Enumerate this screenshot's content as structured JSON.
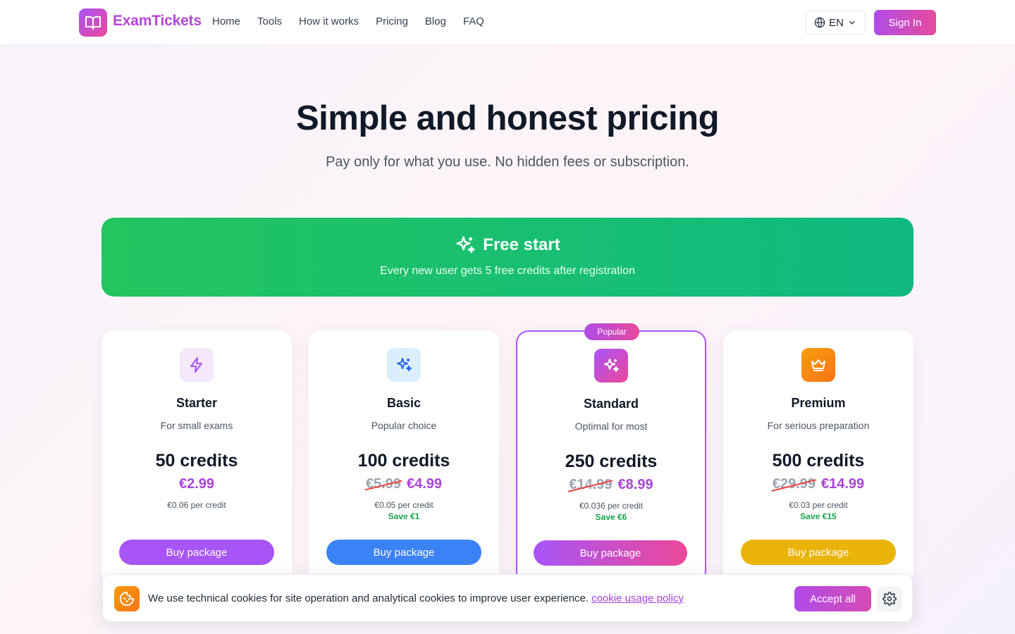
{
  "header": {
    "brand": "ExamTickets",
    "nav": [
      "Home",
      "Tools",
      "How it works",
      "Pricing",
      "Blog",
      "FAQ"
    ],
    "language": "EN",
    "sign_in": "Sign In"
  },
  "hero": {
    "title": "Simple and honest pricing",
    "subtitle": "Pay only for what you use. No hidden fees or subscription."
  },
  "free_banner": {
    "title": "Free start",
    "subtitle": "Every new user gets 5 free credits after registration"
  },
  "plans": [
    {
      "name": "Starter",
      "description": "For small exams",
      "credits": "50 credits",
      "old_price": "",
      "price": "€2.99",
      "per_credit": "€0.06 per credit",
      "save": "",
      "button": "Buy package",
      "icon": "lightning-icon",
      "accent": "#a855f7"
    },
    {
      "name": "Basic",
      "description": "Popular choice",
      "credits": "100 credits",
      "old_price": "€5.99",
      "price": "€4.99",
      "per_credit": "€0.05 per credit",
      "save": "Save €1",
      "button": "Buy package",
      "icon": "sparkles-icon",
      "accent": "#3b82f6"
    },
    {
      "name": "Standard",
      "description": "Optimal for most",
      "credits": "250 credits",
      "old_price": "€14.99",
      "price": "€8.99",
      "per_credit": "€0.036 per credit",
      "save": "Save €6",
      "button": "Buy package",
      "icon": "sparkles-icon",
      "accent": "#c04ddc",
      "badge": "Popular"
    },
    {
      "name": "Premium",
      "description": "For serious preparation",
      "credits": "500 credits",
      "old_price": "€29.99",
      "price": "€14.99",
      "per_credit": "€0.03 per credit",
      "save": "Save €15",
      "button": "Buy package",
      "icon": "crown-icon",
      "accent": "#eab308"
    }
  ],
  "cookie": {
    "text": "We use technical cookies for site operation and analytical cookies to improve user experience.",
    "link": "cookie usage policy",
    "accept": "Accept all"
  }
}
